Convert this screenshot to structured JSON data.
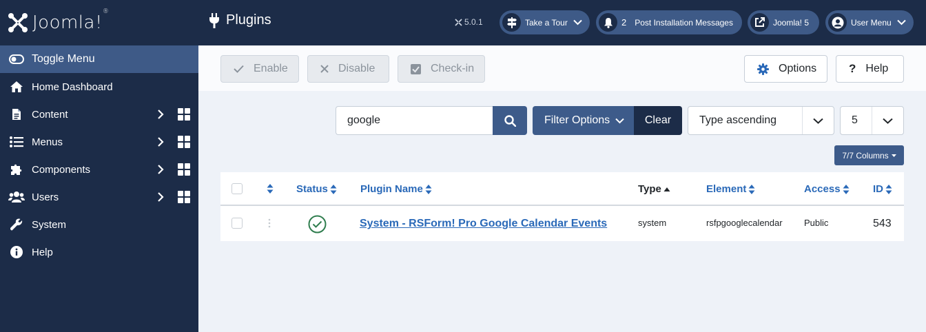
{
  "app": {
    "logo_text": "Joomla!",
    "logo_reg": "®",
    "version": "5.0.1"
  },
  "header": {
    "title": "Plugins",
    "take_tour": "Take a Tour",
    "post_install_count": "2",
    "post_install": "Post Installation Messages",
    "site_link": "Joomla! 5",
    "user_menu": "User Menu"
  },
  "sidebar": {
    "toggle": "Toggle Menu",
    "items": [
      {
        "label": "Home Dashboard",
        "icon": "home-icon"
      },
      {
        "label": "Content",
        "icon": "file-icon"
      },
      {
        "label": "Menus",
        "icon": "list-icon"
      },
      {
        "label": "Components",
        "icon": "puzzle-icon"
      },
      {
        "label": "Users",
        "icon": "users-icon"
      },
      {
        "label": "System",
        "icon": "wrench-icon"
      },
      {
        "label": "Help",
        "icon": "info-icon"
      }
    ]
  },
  "toolbar": {
    "enable": "Enable",
    "disable": "Disable",
    "checkin": "Check-in",
    "options": "Options",
    "help": "Help"
  },
  "search": {
    "value": "google",
    "filter_options": "Filter Options",
    "clear": "Clear",
    "ordering": "Type ascending",
    "limit": "5",
    "columns": "7/7 Columns"
  },
  "table": {
    "headers": {
      "status": "Status",
      "name": "Plugin Name",
      "type": "Type",
      "element": "Element",
      "access": "Access",
      "id": "ID"
    },
    "rows": [
      {
        "name": "System - RSForm! Pro Google Calendar Events",
        "type": "system",
        "element": "rsfpgooglecalendar",
        "access": "Public",
        "id": "543",
        "status": "enabled"
      }
    ]
  },
  "colors": {
    "sidebar_bg": "#1c2c48",
    "accent": "#3d5b8a",
    "link": "#2a69b8",
    "success": "#2f7d4e",
    "page_bg": "#eef2f8"
  }
}
